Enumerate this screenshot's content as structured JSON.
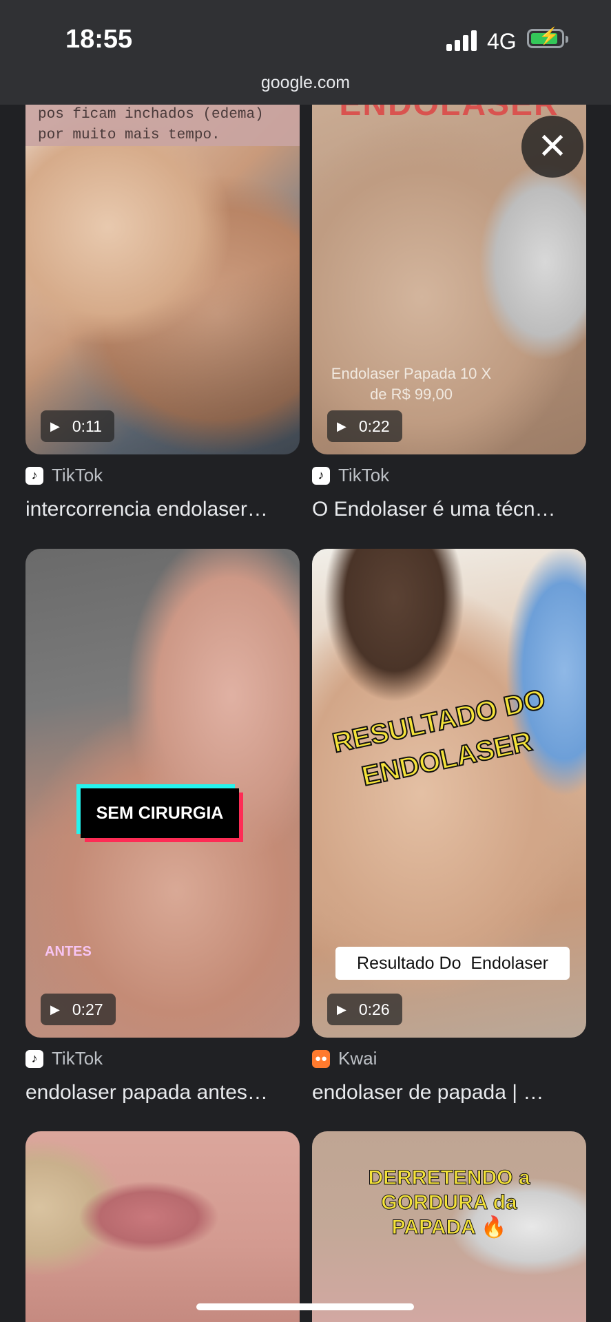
{
  "status": {
    "time": "18:55",
    "network": "4G",
    "url": "google.com"
  },
  "results": [
    {
      "duration": "0:11",
      "source": "TikTok",
      "source_icon": "tiktok-icon",
      "title": "intercorrencia endolaser…",
      "overlay": "pos ficam inchados (edema) por muito mais tempo."
    },
    {
      "duration": "0:22",
      "source": "TikTok",
      "source_icon": "tiktok-icon",
      "title": "O Endolaser é uma técn…",
      "overlay": "ENDOLASER",
      "overlay2": "Endolaser Papada 10 X de R$ 99,00"
    },
    {
      "duration": "0:27",
      "source": "TikTok",
      "source_icon": "tiktok-icon",
      "title": "endolaser papada antes…",
      "overlay": "SEM CIRURGIA",
      "overlay2": "ANTES"
    },
    {
      "duration": "0:26",
      "source": "Kwai",
      "source_icon": "kwai-icon",
      "title": "endolaser de papada | …",
      "overlay": "RESULTADO DO ENDOLASER",
      "overlay2": "Resultado Do  Endolaser"
    },
    {
      "overlay": ""
    },
    {
      "overlay": "DERRETENDO a GORDURA da PAPADA 🔥"
    }
  ],
  "colors": {
    "background": "#202124",
    "statusbar": "#303134",
    "battery": "#34c759"
  }
}
